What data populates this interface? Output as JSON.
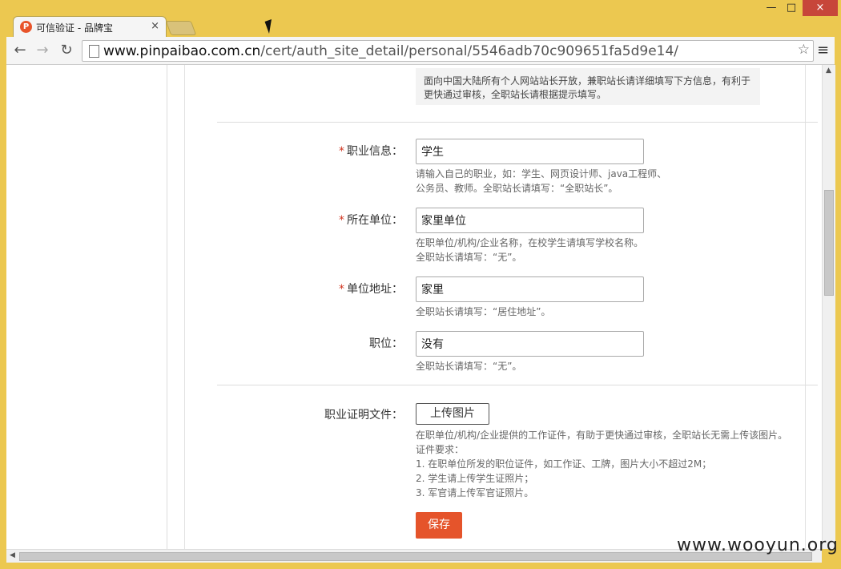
{
  "browser": {
    "tab_title": "可信验证 - 品牌宝",
    "favicon_letter": "P",
    "tab_close": "×",
    "url_host": "www.pinpaibao.com.cn",
    "url_path": "/cert/auth_site_detail/personal/5546adb70c909651fa5d9e14/",
    "star": "☆",
    "menu": "≡",
    "back": "←",
    "forward": "→",
    "reload": "↻",
    "win_min": "—",
    "win_max": "□",
    "win_close": "×"
  },
  "notice": {
    "text_line1": "面向中国大陆所有个人网站站长开放，兼职站长请详细填写下方信息，有利于",
    "text_line2": "更快通过审核，全职站长请根据提示填写。"
  },
  "form": {
    "required_mark": "*",
    "occupation": {
      "label": "职业信息：",
      "value": "学生",
      "hint_line1": "请输入自己的职业，如：学生、网页设计师、java工程师、",
      "hint_line2": "公务员、教师。全职站长请填写：“全职站长”。"
    },
    "employer": {
      "label": "所在单位：",
      "value": "家里单位",
      "hint_line1": "在职单位/机构/企业名称，在校学生请填写学校名称。",
      "hint_line2": "全职站长请填写：“无”。"
    },
    "address": {
      "label": "单位地址：",
      "value": "家里",
      "hint_line1": "全职站长请填写：“居住地址”。"
    },
    "position": {
      "label": "职位：",
      "value": "没有",
      "hint_line1": "全职站长请填写：“无”。"
    },
    "proof": {
      "label": "职业证明文件：",
      "upload_label": "上传图片",
      "hint_line1": "在职单位/机构/企业提供的工作证件，有助于更快通过审核，全职站长无需上传该图片。",
      "hint_line2": "证件要求：",
      "hint_line3": "1. 在职单位所发的职位证件，如工作证、工牌，图片大小不超过2M；",
      "hint_line4": "2. 学生请上传学生证照片；",
      "hint_line5": "3. 军官请上传军官证照片。"
    },
    "save_label": "保存"
  },
  "watermark": "www.wooyun.org",
  "colors": {
    "accent": "#e5542b",
    "required": "#d0341f",
    "frame": "#ecc850"
  }
}
